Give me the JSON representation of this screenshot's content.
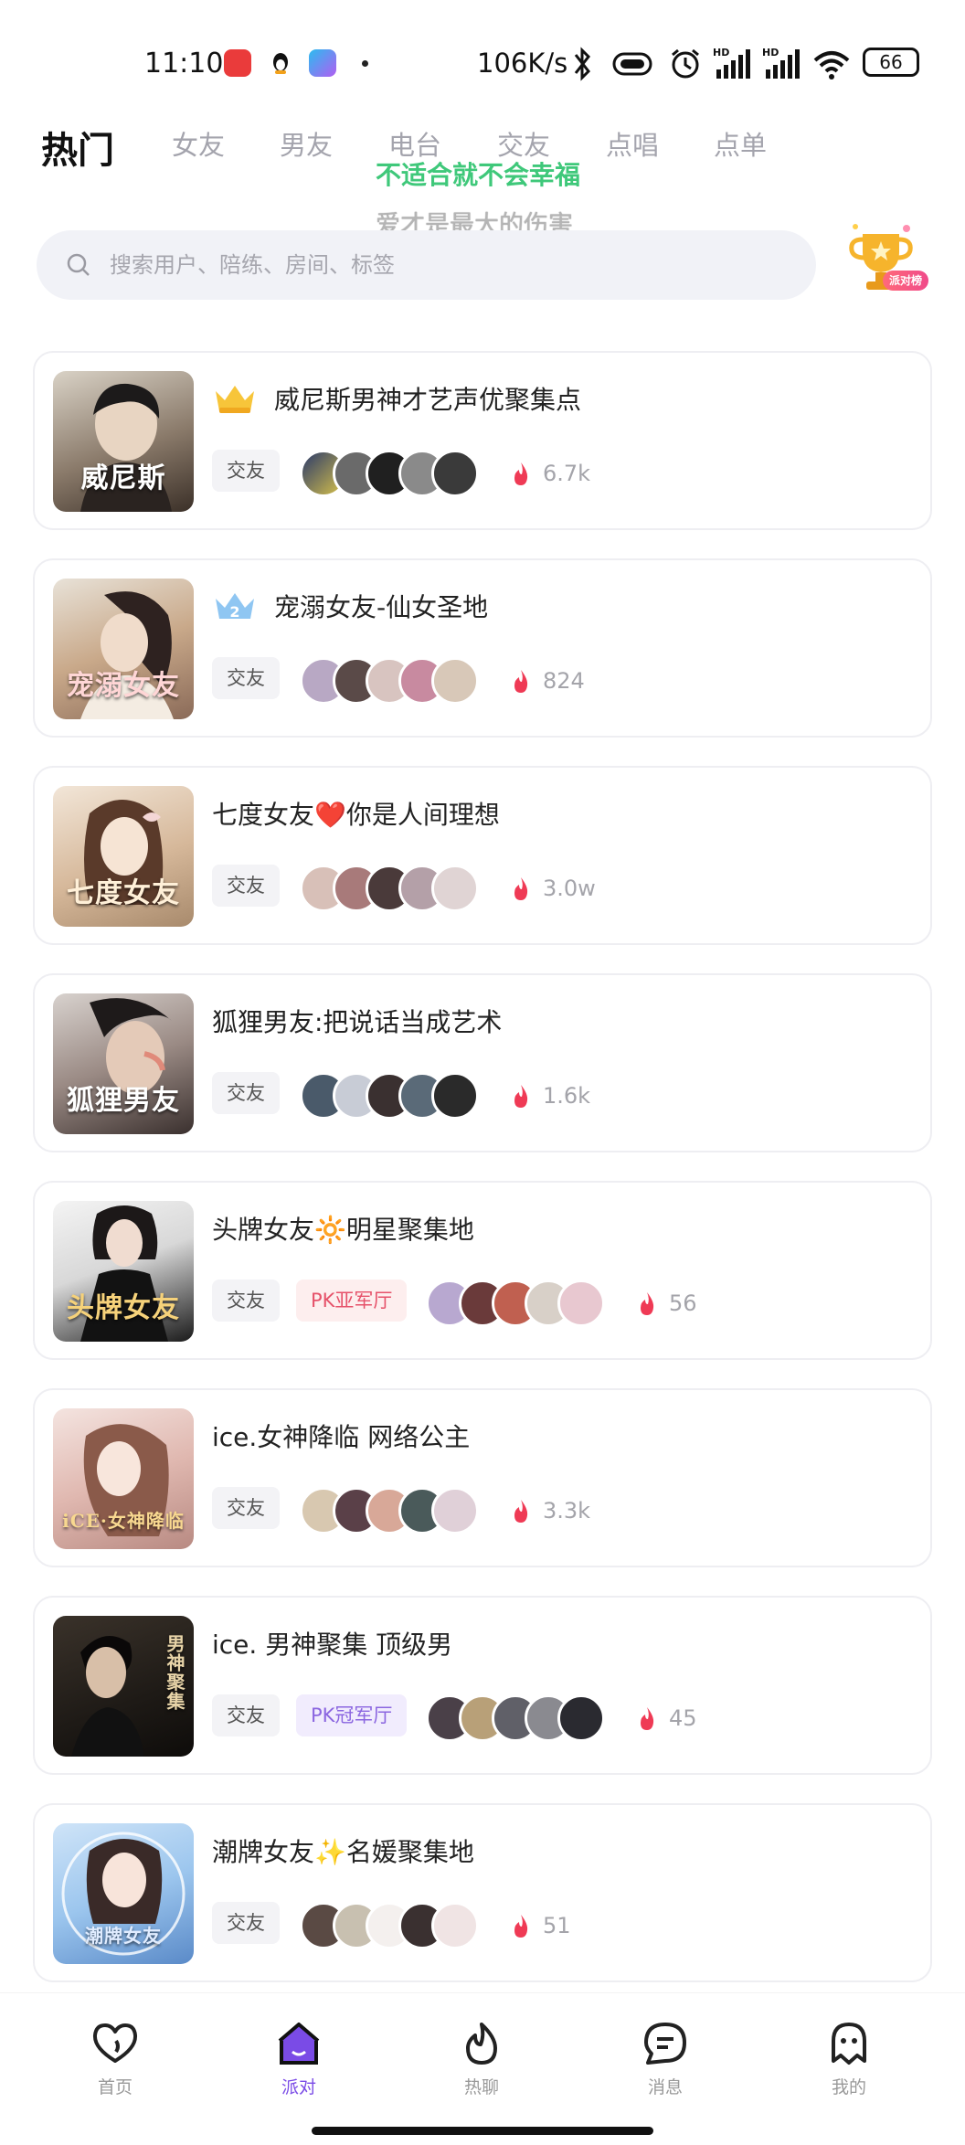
{
  "status_bar": {
    "time": "11:10",
    "net_speed": "106K/s",
    "battery": "66"
  },
  "tabs": [
    "热门",
    "女友",
    "男友",
    "电台",
    "交友",
    "点唱",
    "点单"
  ],
  "lyrics": {
    "line1": "不适合就不会幸福",
    "line2": "爱才是最大的伤害"
  },
  "search": {
    "placeholder": "搜索用户、陪练、房间、标签"
  },
  "rank_badge_label": "派对榜",
  "rooms": [
    {
      "title": "威尼斯男神才艺声优聚集点",
      "badge": "crown-icon",
      "type": "交友",
      "pk": "",
      "heat": "6.7k",
      "cover_text": "威尼斯"
    },
    {
      "title": "宠溺女友-仙女圣地",
      "badge": "rank-2-icon",
      "type": "交友",
      "pk": "",
      "heat": "824",
      "cover_text": "宠溺女友"
    },
    {
      "title": "七度女友❤️你是人间理想",
      "badge": "",
      "type": "交友",
      "pk": "",
      "heat": "3.0w",
      "cover_text": "七度女友"
    },
    {
      "title": "狐狸男友:把说话当成艺术",
      "badge": "",
      "type": "交友",
      "pk": "",
      "heat": "1.6k",
      "cover_text": "狐狸男友"
    },
    {
      "title": "头牌女友🔆明星聚集地",
      "badge": "",
      "type": "交友",
      "pk": "PK亚军厅",
      "pk_style": "red",
      "heat": "56",
      "cover_text": "头牌女友"
    },
    {
      "title": "ice.女神降临  网络公主",
      "badge": "",
      "type": "交友",
      "pk": "",
      "heat": "3.3k",
      "cover_text": "iCE·女神降临"
    },
    {
      "title": "ice. 男神聚集  顶级男",
      "badge": "",
      "type": "交友",
      "pk": "PK冠军厅",
      "pk_style": "purple",
      "heat": "45",
      "cover_text": "男神聚集"
    },
    {
      "title": "潮牌女友✨名媛聚集地",
      "badge": "",
      "type": "交友",
      "pk": "",
      "heat": "51",
      "cover_text": "潮牌女友"
    }
  ],
  "bottom_nav": [
    {
      "label": "首页",
      "icon": "heart-icon"
    },
    {
      "label": "派对",
      "icon": "party-house-icon",
      "active": true
    },
    {
      "label": "热聊",
      "icon": "flame-icon"
    },
    {
      "label": "消息",
      "icon": "message-icon"
    },
    {
      "label": "我的",
      "icon": "ghost-profile-icon"
    }
  ],
  "colors": {
    "accent": "#7a4be6",
    "lyric": "#3fc87a",
    "heat": "#ef3a55",
    "pk_red_bg": "#fdeeee",
    "pk_red_fg": "#e6526a",
    "pk_purple_bg": "#f1ecfd",
    "pk_purple_fg": "#8b66e0"
  }
}
